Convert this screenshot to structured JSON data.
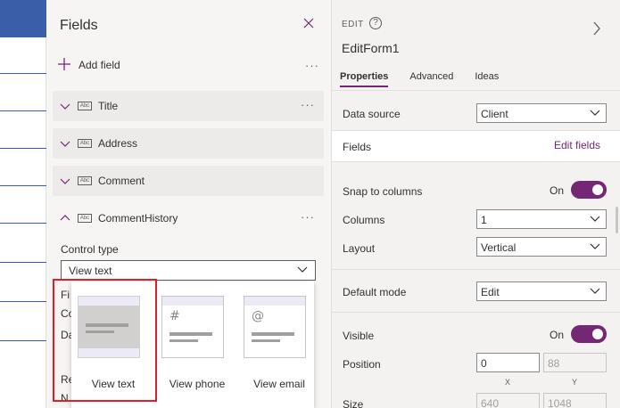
{
  "fields_pane": {
    "title": "Fields",
    "add_field_label": "Add field",
    "more": "···",
    "fields": [
      {
        "name": "Title",
        "expanded": false
      },
      {
        "name": "Address",
        "expanded": false
      },
      {
        "name": "Comment",
        "expanded": false
      },
      {
        "name": "CommentHistory",
        "expanded": true
      }
    ],
    "abc_glyph": "Abc",
    "control_type_label": "Control type",
    "control_type_value": "View text",
    "underlying_text": [
      "Fi",
      "Co",
      "Da",
      "Re",
      "N"
    ],
    "options": [
      {
        "label": "View text",
        "glyph": "",
        "selected": true
      },
      {
        "label": "View phone",
        "glyph": "#",
        "selected": false
      },
      {
        "label": "View email",
        "glyph": "@",
        "selected": false
      }
    ]
  },
  "properties_pane": {
    "section_label": "EDIT",
    "help_glyph": "?",
    "form_name": "EditForm1",
    "tabs": [
      "Properties",
      "Advanced",
      "Ideas"
    ],
    "active_tab": "Properties",
    "data_source_label": "Data source",
    "data_source_value": "Client",
    "fields_label": "Fields",
    "edit_fields_link": "Edit fields",
    "snap_label": "Snap to columns",
    "snap_state": "On",
    "columns_label": "Columns",
    "columns_value": "1",
    "layout_label": "Layout",
    "layout_value": "Vertical",
    "default_mode_label": "Default mode",
    "default_mode_value": "Edit",
    "visible_label": "Visible",
    "visible_state": "On",
    "position_label": "Position",
    "position_x": "0",
    "position_y": "88",
    "x_label": "X",
    "y_label": "Y",
    "size_label": "Size",
    "size_w": "640",
    "size_h": "1048"
  },
  "colors": {
    "accent": "#742774",
    "canvas_blue": "#3b5ea8",
    "selection_outline": "#e01e2a"
  },
  "icons": [
    "close-icon",
    "plus-icon",
    "more-icon",
    "chevron-down-icon",
    "chevron-up-icon",
    "abc-text-icon",
    "help-icon",
    "chevron-right-icon"
  ]
}
